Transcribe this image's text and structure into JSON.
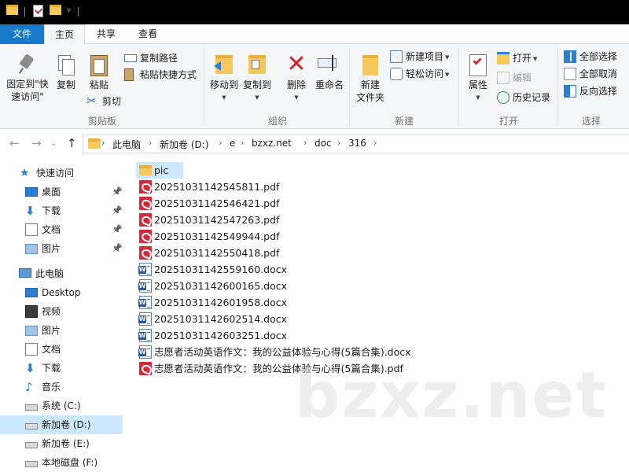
{
  "ribbon_tabs": {
    "file": "文件",
    "home": "主页",
    "share": "共享",
    "view": "查看"
  },
  "clipboard": {
    "pin_to_quick_access": "固定到\"快",
    "pin_to_quick_access_line2": "速访问\"",
    "copy": "复制",
    "paste": "粘贴",
    "copy_path": "复制路径",
    "paste_shortcut": "粘贴快捷方式",
    "cut": "剪切",
    "label": "剪贴板"
  },
  "organize": {
    "move_to": "移动到",
    "copy_to": "复制到",
    "delete": "删除",
    "rename": "重命名",
    "label": "组织"
  },
  "new": {
    "new_folder": "新建",
    "new_folder_line2": "文件夹",
    "new_item": "新建项目",
    "easy_access": "轻松访问",
    "label": "新建"
  },
  "open": {
    "properties": "属性",
    "open": "打开",
    "edit": "编辑",
    "history": "历史记录",
    "label": "打开"
  },
  "select": {
    "select_all": "全部选择",
    "select_none": "全部取消",
    "invert": "反向选择",
    "label": "选择"
  },
  "breadcrumb": [
    "此电脑",
    "新加卷 (D:)",
    "e",
    "bzxz.net",
    "doc",
    "316"
  ],
  "nav": {
    "quick_access": "快速访问",
    "quick_items": [
      "桌面",
      "下载",
      "文档",
      "图片"
    ],
    "this_pc": "此电脑",
    "pc_items": [
      "Desktop",
      "视频",
      "图片",
      "文档",
      "下载",
      "音乐",
      "系统 (C:)",
      "新加卷 (D:)",
      "新加卷 (E:)",
      "本地磁盘 (F:)"
    ]
  },
  "files": [
    {
      "name": "pic",
      "type": "folder"
    },
    {
      "name": "20251031142545811.pdf",
      "type": "pdf"
    },
    {
      "name": "20251031142546421.pdf",
      "type": "pdf"
    },
    {
      "name": "20251031142547263.pdf",
      "type": "pdf"
    },
    {
      "name": "20251031142549944.pdf",
      "type": "pdf"
    },
    {
      "name": "20251031142550418.pdf",
      "type": "pdf"
    },
    {
      "name": "20251031142559160.docx",
      "type": "docx"
    },
    {
      "name": "20251031142600165.docx",
      "type": "docx"
    },
    {
      "name": "20251031142601958.docx",
      "type": "docx"
    },
    {
      "name": "20251031142602514.docx",
      "type": "docx"
    },
    {
      "name": "20251031142603251.docx",
      "type": "docx"
    },
    {
      "name": "志愿者活动英语作文：我的公益体验与心得(5篇合集).docx",
      "type": "docx"
    },
    {
      "name": "志愿者活动英语作文：我的公益体验与心得(5篇合集).pdf",
      "type": "pdf"
    }
  ],
  "watermark": "bzxz.net",
  "colors": {
    "file_tab": "#1979ca",
    "selection": "#cce8ff",
    "folder": "#f6c75a",
    "pdf": "#d6283b",
    "word": "#2b5797"
  }
}
